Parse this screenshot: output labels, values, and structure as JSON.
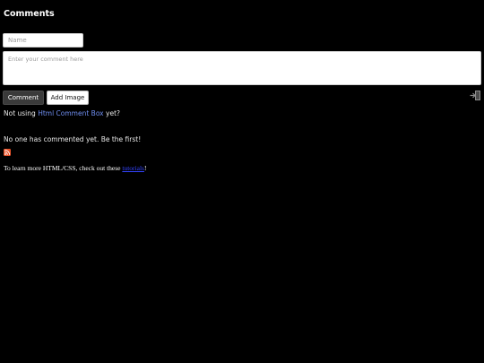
{
  "header": {
    "title": "Comments"
  },
  "form": {
    "name_placeholder": "Name",
    "comment_placeholder": "Enter your comment here",
    "comment_button": "Comment",
    "add_image_button": "Add Image"
  },
  "promo": {
    "prefix": "Not using",
    "link_text": "Html Comment Box",
    "suffix": "yet?"
  },
  "comments": {
    "empty_message": "No one has commented yet. Be the first!"
  },
  "icons": {
    "login": "login-icon",
    "rss": "rss-icon"
  },
  "colors": {
    "background": "#000000",
    "link": "#6f8ef0",
    "rss": "#e8532a",
    "footer_link": "#3344ff"
  },
  "footer": {
    "prefix": "To learn more HTML/CSS, check out these",
    "link_text": "tutorials",
    "suffix": "!"
  }
}
